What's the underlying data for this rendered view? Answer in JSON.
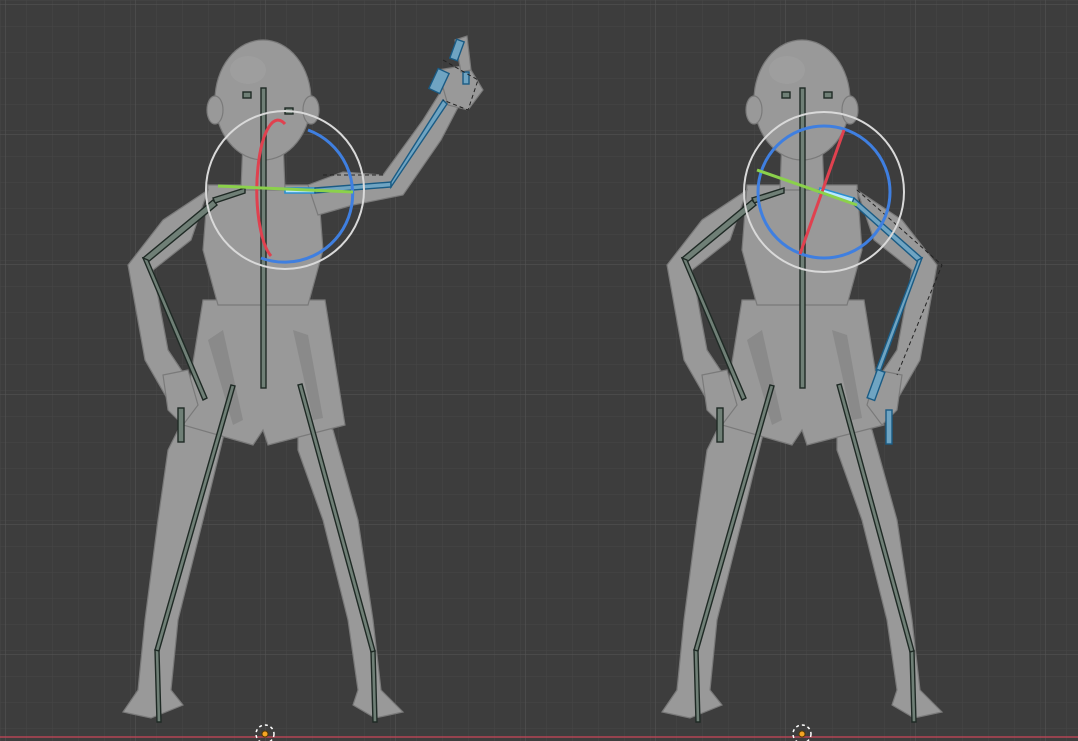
{
  "editor": "3D Viewport",
  "view": "front-orthographic",
  "colors": {
    "background": "#3d3d3d",
    "grid_minor": "#474747",
    "grid_major": "#525252",
    "x_axis": "#b34555",
    "gizmo_x": "#e0414f",
    "gizmo_y": "#8bd14b",
    "gizmo_z": "#3f7fe0",
    "selected_bone": "#6fa4c2"
  },
  "icons": {
    "origin_left": "3d-cursor-icon",
    "origin_right": "3d-cursor-icon"
  }
}
